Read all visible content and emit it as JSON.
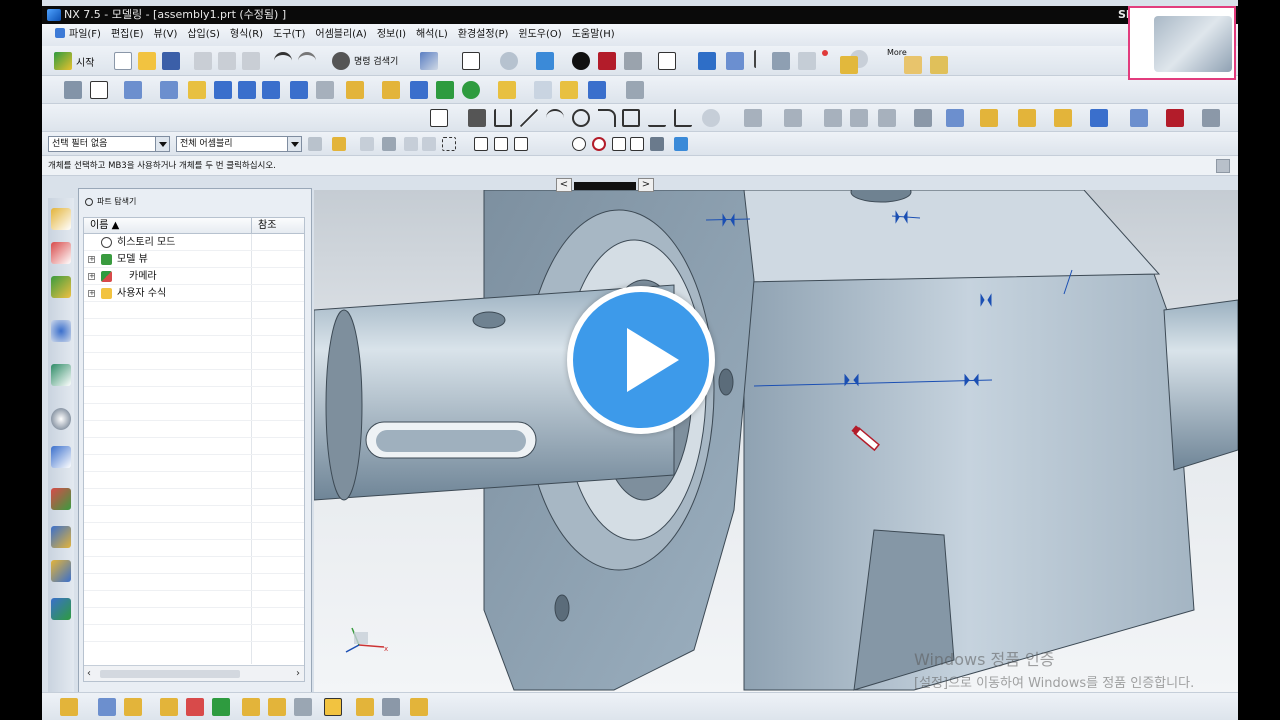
{
  "window": {
    "title": "NX 7.5 - 모델링 - [assembly1.prt (수정됨) ]",
    "brand_fragment": "SI"
  },
  "menubar": {
    "items": [
      "파일(F)",
      "편집(E)",
      "뷰(V)",
      "삽입(S)",
      "형식(R)",
      "도구(T)",
      "어셈블리(A)",
      "정보(I)",
      "해석(L)",
      "환경설정(P)",
      "윈도우(O)",
      "도움말(H)"
    ]
  },
  "toolbar": {
    "start_label": "시작",
    "command_search_label": "명령 검색기",
    "more_label": "More"
  },
  "selection_bar": {
    "filter_value": "선택 필터 없음",
    "scope_value": "전체 어셈블리"
  },
  "cue_line": "개체를 선택하고 MB3을 사용하거나 개체를 두 번 클릭하십시오.",
  "part_navigator": {
    "title": "파트 탐색기",
    "columns": [
      "이름",
      "참조"
    ],
    "rows": [
      {
        "label": "히스토리 모드",
        "icon": "clock-icon",
        "expandable": false
      },
      {
        "label": "모델 뷰",
        "icon": "model-view-icon",
        "expandable": true
      },
      {
        "label": "카메라",
        "icon": "camera-icon",
        "expandable": true
      },
      {
        "label": "사용자 수식",
        "icon": "folder-icon",
        "expandable": true
      }
    ]
  },
  "viewport": {
    "triad_label": "x"
  },
  "watermark": {
    "line1": "Windows 정품 인증",
    "line2": "[설정]으로 이동하여 Windows를 정품 인증합니다."
  },
  "colors": {
    "play_button": "#3d9aea",
    "thumbnail_border": "#e23c7d",
    "dimension_blue": "#1b4fb3"
  }
}
